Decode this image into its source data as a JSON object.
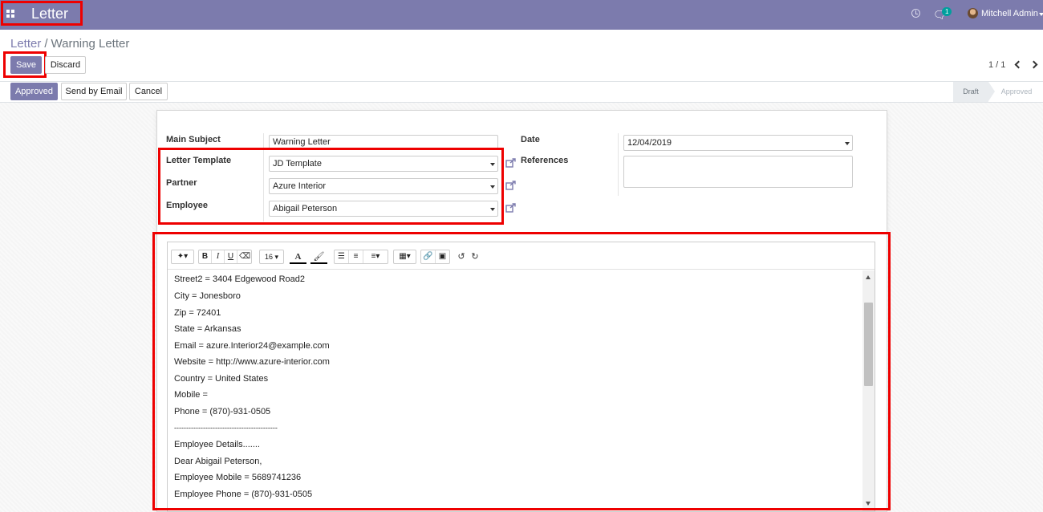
{
  "navbar": {
    "app_title": "Letter",
    "chat_badge": "1",
    "user_name": "Mitchell Admin"
  },
  "breadcrumb": {
    "parent": "Letter",
    "separator": "/",
    "current": "Warning Letter"
  },
  "actions": {
    "save_label": "Save",
    "discard_label": "Discard"
  },
  "pager": {
    "text": "1 / 1"
  },
  "header_buttons": {
    "approved_label": "Approved",
    "send_email_label": "Send by Email",
    "cancel_label": "Cancel"
  },
  "statusbar": {
    "stages": [
      "Draft",
      "Approved"
    ]
  },
  "form": {
    "main_subject_label": "Main Subject",
    "main_subject_value": "Warning Letter",
    "letter_template_label": "Letter Template",
    "letter_template_value": "JD Template",
    "partner_label": "Partner",
    "partner_value": "Azure Interior",
    "employee_label": "Employee",
    "employee_value": "Abigail Peterson",
    "date_label": "Date",
    "date_value": "12/04/2019",
    "references_label": "References",
    "references_value": ""
  },
  "editor": {
    "toolbar": {
      "bold": "B",
      "italic": "I",
      "underline": "U",
      "font_size": "16",
      "font_color": "A"
    },
    "lines": [
      "Street2 = 3404 Edgewood Road2",
      "City = Jonesboro",
      "Zip = 72401",
      "State = Arkansas",
      "Email = azure.Interior24@example.com",
      "Website = http://www.azure-interior.com",
      "Country = United States",
      "Mobile =",
      "Phone = (870)-931-0505",
      "-------------------------------------------",
      "Employee Details.......",
      "Dear Abigail Peterson,",
      "Employee Mobile = 5689741236",
      "Employee Phone = (870)-931-0505"
    ]
  },
  "colors": {
    "brand": "#7c7bad",
    "highlight": "#ee0000"
  }
}
